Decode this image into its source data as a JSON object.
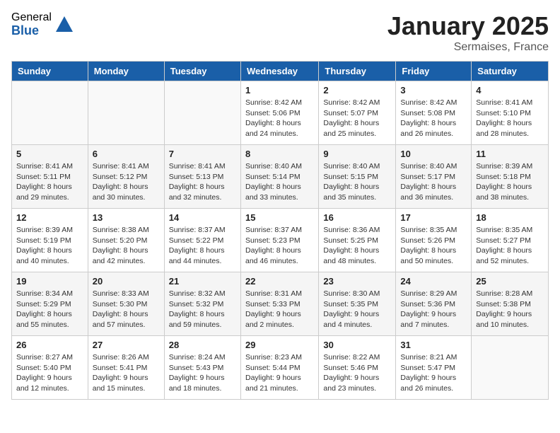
{
  "logo": {
    "general": "General",
    "blue": "Blue"
  },
  "header": {
    "month": "January 2025",
    "location": "Sermaises, France"
  },
  "weekdays": [
    "Sunday",
    "Monday",
    "Tuesday",
    "Wednesday",
    "Thursday",
    "Friday",
    "Saturday"
  ],
  "weeks": [
    [
      {
        "day": "",
        "sunrise": "",
        "sunset": "",
        "daylight": ""
      },
      {
        "day": "",
        "sunrise": "",
        "sunset": "",
        "daylight": ""
      },
      {
        "day": "",
        "sunrise": "",
        "sunset": "",
        "daylight": ""
      },
      {
        "day": "1",
        "sunrise": "Sunrise: 8:42 AM",
        "sunset": "Sunset: 5:06 PM",
        "daylight": "Daylight: 8 hours and 24 minutes."
      },
      {
        "day": "2",
        "sunrise": "Sunrise: 8:42 AM",
        "sunset": "Sunset: 5:07 PM",
        "daylight": "Daylight: 8 hours and 25 minutes."
      },
      {
        "day": "3",
        "sunrise": "Sunrise: 8:42 AM",
        "sunset": "Sunset: 5:08 PM",
        "daylight": "Daylight: 8 hours and 26 minutes."
      },
      {
        "day": "4",
        "sunrise": "Sunrise: 8:41 AM",
        "sunset": "Sunset: 5:10 PM",
        "daylight": "Daylight: 8 hours and 28 minutes."
      }
    ],
    [
      {
        "day": "5",
        "sunrise": "Sunrise: 8:41 AM",
        "sunset": "Sunset: 5:11 PM",
        "daylight": "Daylight: 8 hours and 29 minutes."
      },
      {
        "day": "6",
        "sunrise": "Sunrise: 8:41 AM",
        "sunset": "Sunset: 5:12 PM",
        "daylight": "Daylight: 8 hours and 30 minutes."
      },
      {
        "day": "7",
        "sunrise": "Sunrise: 8:41 AM",
        "sunset": "Sunset: 5:13 PM",
        "daylight": "Daylight: 8 hours and 32 minutes."
      },
      {
        "day": "8",
        "sunrise": "Sunrise: 8:40 AM",
        "sunset": "Sunset: 5:14 PM",
        "daylight": "Daylight: 8 hours and 33 minutes."
      },
      {
        "day": "9",
        "sunrise": "Sunrise: 8:40 AM",
        "sunset": "Sunset: 5:15 PM",
        "daylight": "Daylight: 8 hours and 35 minutes."
      },
      {
        "day": "10",
        "sunrise": "Sunrise: 8:40 AM",
        "sunset": "Sunset: 5:17 PM",
        "daylight": "Daylight: 8 hours and 36 minutes."
      },
      {
        "day": "11",
        "sunrise": "Sunrise: 8:39 AM",
        "sunset": "Sunset: 5:18 PM",
        "daylight": "Daylight: 8 hours and 38 minutes."
      }
    ],
    [
      {
        "day": "12",
        "sunrise": "Sunrise: 8:39 AM",
        "sunset": "Sunset: 5:19 PM",
        "daylight": "Daylight: 8 hours and 40 minutes."
      },
      {
        "day": "13",
        "sunrise": "Sunrise: 8:38 AM",
        "sunset": "Sunset: 5:20 PM",
        "daylight": "Daylight: 8 hours and 42 minutes."
      },
      {
        "day": "14",
        "sunrise": "Sunrise: 8:37 AM",
        "sunset": "Sunset: 5:22 PM",
        "daylight": "Daylight: 8 hours and 44 minutes."
      },
      {
        "day": "15",
        "sunrise": "Sunrise: 8:37 AM",
        "sunset": "Sunset: 5:23 PM",
        "daylight": "Daylight: 8 hours and 46 minutes."
      },
      {
        "day": "16",
        "sunrise": "Sunrise: 8:36 AM",
        "sunset": "Sunset: 5:25 PM",
        "daylight": "Daylight: 8 hours and 48 minutes."
      },
      {
        "day": "17",
        "sunrise": "Sunrise: 8:35 AM",
        "sunset": "Sunset: 5:26 PM",
        "daylight": "Daylight: 8 hours and 50 minutes."
      },
      {
        "day": "18",
        "sunrise": "Sunrise: 8:35 AM",
        "sunset": "Sunset: 5:27 PM",
        "daylight": "Daylight: 8 hours and 52 minutes."
      }
    ],
    [
      {
        "day": "19",
        "sunrise": "Sunrise: 8:34 AM",
        "sunset": "Sunset: 5:29 PM",
        "daylight": "Daylight: 8 hours and 55 minutes."
      },
      {
        "day": "20",
        "sunrise": "Sunrise: 8:33 AM",
        "sunset": "Sunset: 5:30 PM",
        "daylight": "Daylight: 8 hours and 57 minutes."
      },
      {
        "day": "21",
        "sunrise": "Sunrise: 8:32 AM",
        "sunset": "Sunset: 5:32 PM",
        "daylight": "Daylight: 8 hours and 59 minutes."
      },
      {
        "day": "22",
        "sunrise": "Sunrise: 8:31 AM",
        "sunset": "Sunset: 5:33 PM",
        "daylight": "Daylight: 9 hours and 2 minutes."
      },
      {
        "day": "23",
        "sunrise": "Sunrise: 8:30 AM",
        "sunset": "Sunset: 5:35 PM",
        "daylight": "Daylight: 9 hours and 4 minutes."
      },
      {
        "day": "24",
        "sunrise": "Sunrise: 8:29 AM",
        "sunset": "Sunset: 5:36 PM",
        "daylight": "Daylight: 9 hours and 7 minutes."
      },
      {
        "day": "25",
        "sunrise": "Sunrise: 8:28 AM",
        "sunset": "Sunset: 5:38 PM",
        "daylight": "Daylight: 9 hours and 10 minutes."
      }
    ],
    [
      {
        "day": "26",
        "sunrise": "Sunrise: 8:27 AM",
        "sunset": "Sunset: 5:40 PM",
        "daylight": "Daylight: 9 hours and 12 minutes."
      },
      {
        "day": "27",
        "sunrise": "Sunrise: 8:26 AM",
        "sunset": "Sunset: 5:41 PM",
        "daylight": "Daylight: 9 hours and 15 minutes."
      },
      {
        "day": "28",
        "sunrise": "Sunrise: 8:24 AM",
        "sunset": "Sunset: 5:43 PM",
        "daylight": "Daylight: 9 hours and 18 minutes."
      },
      {
        "day": "29",
        "sunrise": "Sunrise: 8:23 AM",
        "sunset": "Sunset: 5:44 PM",
        "daylight": "Daylight: 9 hours and 21 minutes."
      },
      {
        "day": "30",
        "sunrise": "Sunrise: 8:22 AM",
        "sunset": "Sunset: 5:46 PM",
        "daylight": "Daylight: 9 hours and 23 minutes."
      },
      {
        "day": "31",
        "sunrise": "Sunrise: 8:21 AM",
        "sunset": "Sunset: 5:47 PM",
        "daylight": "Daylight: 9 hours and 26 minutes."
      },
      {
        "day": "",
        "sunrise": "",
        "sunset": "",
        "daylight": ""
      }
    ]
  ]
}
